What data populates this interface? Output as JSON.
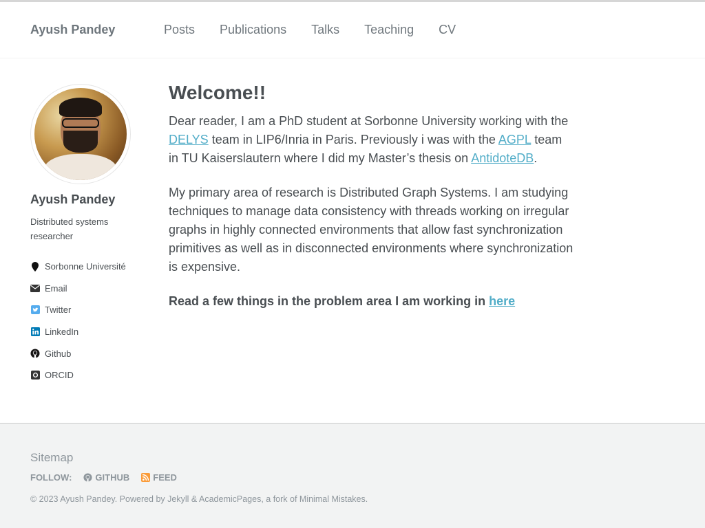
{
  "masthead": {
    "site_title": "Ayush Pandey",
    "nav": [
      "Posts",
      "Publications",
      "Talks",
      "Teaching",
      "CV"
    ]
  },
  "sidebar": {
    "name": "Ayush Pandey",
    "bio": "Distributed systems researcher",
    "links": [
      {
        "label": "Sorbonne Université",
        "icon": "map-marker-icon"
      },
      {
        "label": "Email",
        "icon": "envelope-icon"
      },
      {
        "label": "Twitter",
        "icon": "twitter-icon"
      },
      {
        "label": "LinkedIn",
        "icon": "linkedin-icon"
      },
      {
        "label": "Github",
        "icon": "github-icon"
      },
      {
        "label": "ORCID",
        "icon": "orcid-icon"
      }
    ]
  },
  "main": {
    "title": "Welcome!!",
    "p1": {
      "t1": "Dear reader, I am a PhD student at Sorbonne University working with the ",
      "link1": "DELYS",
      "t2": " team in LIP6/Inria in Paris. Previously i was with the ",
      "link2": "AGPL",
      "t3": " team in TU Kaiserslautern where I did my Master’s thesis on ",
      "link3": "AntidoteDB",
      "t4": "."
    },
    "p2": "My primary area of research is Distributed Graph Systems. I am studying techniques to manage data consistency with threads working on irregular graphs in highly connected environments that allow fast synchronization primitives as well as in disconnected environments where synchronization is expensive.",
    "cta_text": "Read a few things in the problem area I am working in ",
    "cta_link": "here"
  },
  "footer": {
    "sitemap": "Sitemap",
    "follow_label": "Follow:",
    "github": "GitHub",
    "feed": "Feed",
    "copyright": "© 2023 Ayush Pandey. Powered by Jekyll & AcademicPages, a fork of Minimal Mistakes."
  },
  "colors": {
    "link": "#52adc8",
    "twitter": "#55acee",
    "linkedin": "#007bb6",
    "feed": "#fa9b39"
  }
}
